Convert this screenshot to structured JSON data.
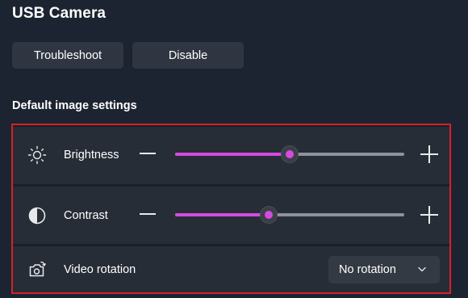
{
  "header": {
    "title": "USB Camera"
  },
  "actions": {
    "troubleshoot_label": "Troubleshoot",
    "disable_label": "Disable"
  },
  "section": {
    "heading": "Default image settings"
  },
  "settings": {
    "brightness": {
      "label": "Brightness",
      "icon": "sun-icon",
      "value_fraction": 0.5
    },
    "contrast": {
      "label": "Contrast",
      "icon": "contrast-icon",
      "value_fraction": 0.41
    },
    "video_rotation": {
      "label": "Video rotation",
      "icon": "camera-rotate-icon",
      "selected": "No rotation"
    }
  },
  "colors": {
    "accent": "#d64ae0",
    "highlight_border": "#d6212b",
    "background": "#1d2431"
  }
}
